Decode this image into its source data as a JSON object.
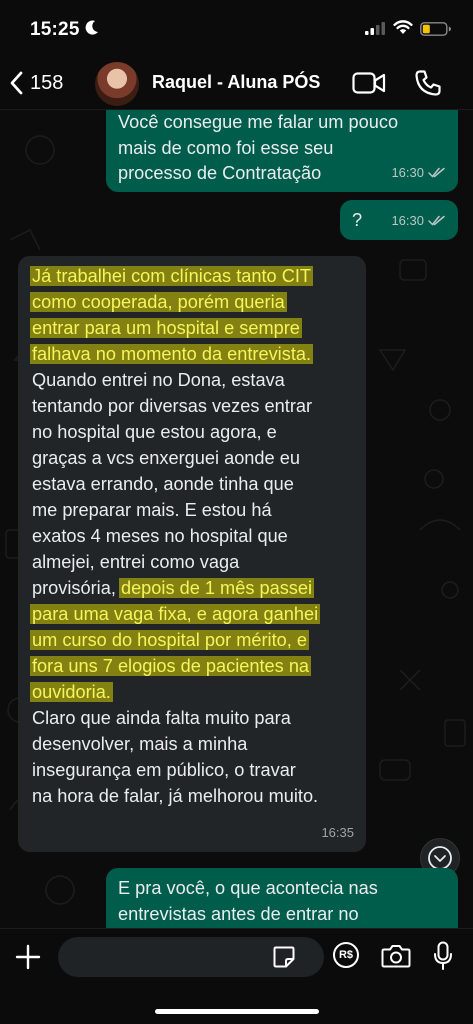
{
  "status_bar": {
    "time": "15:25"
  },
  "header": {
    "back_count": "158",
    "contact_name": "Raquel - Aluna PÓS"
  },
  "messages": [
    {
      "direction": "out",
      "lines": [
        "Você consegue me falar um pouco",
        "mais de como foi esse seu",
        "processo de Contratação"
      ],
      "time": "16:30"
    },
    {
      "direction": "out",
      "text": "?",
      "time": "16:30"
    },
    {
      "direction": "in",
      "lines": [
        "Já trabalhei com clínicas tanto CIT",
        "como cooperada, porém queria",
        "entrar para um hospital e sempre",
        "falhava no momento da entrevista.",
        "Quando entrei no Dona, estava",
        "tentando por diversas vezes entrar",
        "no hospital que estou agora, e",
        "graças a vcs enxerguei aonde eu",
        "estava errando, aonde tinha que",
        "me preparar mais. E estou há",
        "exatos 4 meses no hospital que",
        "almejei, entrei como vaga",
        "provisória, ",
        "depois de 1 mês passei",
        "para uma vaga fixa, e agora ganhei",
        "um curso do hospital por mérito, e",
        "fora uns 7 elogios de pacientes na",
        "ouvidoria.",
        "Claro que ainda falta muito para",
        "desenvolver, mais a minha",
        "insegurança em público, o travar",
        "na hora de falar, já melhorou muito."
      ],
      "time": "16:35"
    },
    {
      "direction": "out",
      "lines": [
        "E pra você, o que acontecia nas",
        "entrevistas antes de entrar no"
      ]
    }
  ],
  "input": {
    "placeholder": "",
    "pay_label": "R$"
  },
  "colors": {
    "outgoing_bubble": "#005c4b",
    "incoming_bubble": "#222528",
    "highlight": "#d4ce00",
    "background": "#0c0c0c"
  }
}
